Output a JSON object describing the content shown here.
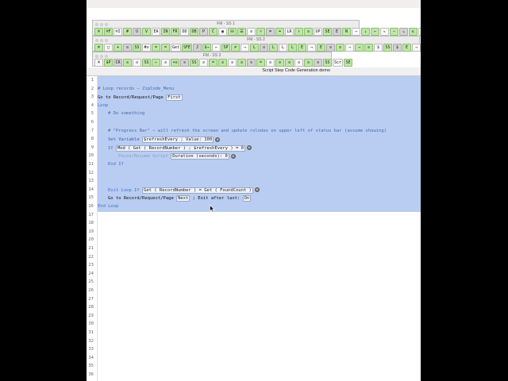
{
  "palettes": [
    {
      "title": "FM - SS 1",
      "rows": [
        [
          "⌘",
          "⌘F",
          "⌘I",
          "#",
          "U",
          "V",
          "EA",
          "IN",
          "FR",
          "DD",
          "DB",
          "P",
          "Ĉ",
          "▣",
          "⛁",
          "☰",
          "≡",
          "☼",
          "⌗",
          "⌨",
          "LR",
          "↑",
          "≡",
          "UP",
          "SE",
          "E",
          "N",
          "→",
          "↓",
          "←",
          "↖",
          "−",
          "↘",
          "⇅",
          "∅",
          "↔"
        ]
      ]
    },
    {
      "title": "FM - SS 2",
      "rows": [
        [
          "⌘",
          "□",
          "+",
          "≡",
          "SS",
          "#≡",
          "=",
          "=",
          "Get",
          "SFE",
          "J",
          "$→",
          "←",
          "SP",
          "≠",
          "→",
          "L",
          "≡",
          "L",
          "L",
          "L",
          "E",
          "→",
          "E",
          "≡",
          "≡",
          "→",
          "→",
          "≡",
          "$",
          "SS",
          "$",
          "E",
          "→",
          "#",
          "→",
          "→",
          "E",
          "E",
          "→"
        ]
      ]
    },
    {
      "title": "FM - SS 3",
      "rows": [
        [
          "⌘",
          "$P",
          "CR",
          "≡",
          "≡",
          "SS",
          "←",
          "≡",
          "+≡",
          "≡",
          "SS",
          "≡",
          "=",
          "≡",
          "≡",
          "≡",
          "≡",
          "=",
          "≡",
          "≡",
          "≡",
          "≡",
          "≡",
          "≡",
          "SS",
          "Scr",
          "SE"
        ]
      ]
    }
  ],
  "window": {
    "title": "Script Step Code Generation demo"
  },
  "editor": {
    "line_numbers": [
      "1",
      "2",
      "3",
      "4",
      "5",
      "6",
      "7",
      "8",
      "9",
      "10",
      "11",
      "12",
      "13",
      "14",
      "15",
      "16",
      "17",
      "18",
      "19",
      "20",
      "21",
      "22",
      "23",
      "24",
      "25",
      "26",
      "27",
      "28",
      "29",
      "30",
      "31",
      "32",
      "33",
      "34",
      "35",
      "36"
    ],
    "lines": [
      {
        "n": 2,
        "indent": 0,
        "parts": [
          {
            "cls": "c-comment",
            "text": "# Loop records – ZipCode_Menu"
          }
        ]
      },
      {
        "n": 3,
        "indent": 0,
        "parts": [
          {
            "cls": "c-step",
            "text": "Go to Record/Request/Page "
          },
          {
            "box": true,
            "text": "First"
          }
        ]
      },
      {
        "n": 4,
        "indent": 0,
        "parts": [
          {
            "cls": "c-ctrl",
            "text": "Loop"
          }
        ]
      },
      {
        "n": 5,
        "indent": 1,
        "parts": [
          {
            "cls": "c-comment",
            "text": "# Do something"
          }
        ]
      },
      {
        "n": 7,
        "indent": 1,
        "parts": [
          {
            "cls": "c-comment",
            "text": "# \"Progress Bar\" – will refresh the screen and update rolodex on upper left of status bar (assume showing)"
          }
        ]
      },
      {
        "n": 8,
        "indent": 1,
        "parts": [
          {
            "cls": "c-var",
            "text": "Set Variable "
          },
          {
            "box": true,
            "text": "$refreshEvery ; Value: 100"
          },
          {
            "gear": true
          }
        ]
      },
      {
        "n": 9,
        "indent": 1,
        "parts": [
          {
            "cls": "c-ctrl",
            "text": "If "
          },
          {
            "box": true,
            "text": "Mod ( Get ( RecordNumber ) ; $refreshEvery ) = 0"
          },
          {
            "gear": true
          }
        ]
      },
      {
        "n": 10,
        "indent": 2,
        "parts": [
          {
            "cls": "c-dis",
            "text": "Pause/Resume Script "
          },
          {
            "box": true,
            "text": "Duration (seconds): 0"
          },
          {
            "gear": true
          }
        ]
      },
      {
        "n": 11,
        "indent": 1,
        "parts": [
          {
            "cls": "c-ctrl",
            "text": "End If"
          }
        ]
      },
      {
        "n": 14,
        "indent": 1,
        "parts": [
          {
            "cls": "c-ctrl",
            "text": "Exit Loop If "
          },
          {
            "box": true,
            "text": "Get ( RecordNumber ) = Get ( FoundCount )"
          },
          {
            "gear": true
          }
        ]
      },
      {
        "n": 15,
        "indent": 1,
        "parts": [
          {
            "cls": "c-step",
            "text": "Go to Record/Request/Page "
          },
          {
            "box": true,
            "text": "Next"
          },
          {
            "cls": "c-step",
            "text": " ; Exit after last: "
          },
          {
            "box": true,
            "text": "On"
          }
        ]
      },
      {
        "n": 16,
        "indent": 0,
        "parts": [
          {
            "cls": "c-ctrl",
            "text": "End Loop"
          }
        ]
      }
    ]
  },
  "colors": {
    "selection": "#b8cdf1",
    "comment": "#4c6aa9",
    "control": "#4870c8",
    "green_button": "#bfe6a8"
  }
}
